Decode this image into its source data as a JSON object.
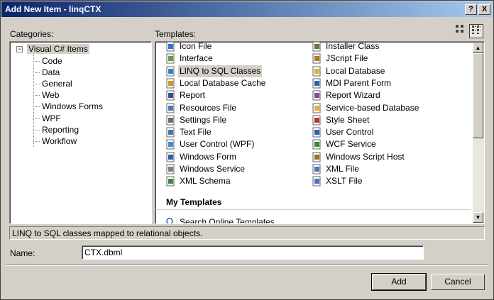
{
  "window": {
    "title": "Add New Item - linqCTX",
    "help_btn": "?",
    "close_btn": "X"
  },
  "categories": {
    "label": "Categories:",
    "root": "Visual C# Items",
    "items": [
      "Code",
      "Data",
      "General",
      "Web",
      "Windows Forms",
      "WPF",
      "Reporting",
      "Workflow"
    ]
  },
  "templates": {
    "label": "Templates:",
    "left": [
      {
        "name": "Icon File",
        "icon": "icon-file-icon",
        "color": "#3b6cc9"
      },
      {
        "name": "Interface",
        "icon": "interface-icon",
        "color": "#5aa33e"
      },
      {
        "name": "LINQ to SQL Classes",
        "icon": "linq-to-sql-icon",
        "color": "#2e7fd1"
      },
      {
        "name": "Local Database Cache",
        "icon": "database-cache-icon",
        "color": "#c99a24"
      },
      {
        "name": "Report",
        "icon": "report-icon",
        "color": "#2f4f8f"
      },
      {
        "name": "Resources File",
        "icon": "resources-file-icon",
        "color": "#4a78b8"
      },
      {
        "name": "Settings File",
        "icon": "settings-file-icon",
        "color": "#6b6b6b"
      },
      {
        "name": "Text File",
        "icon": "text-file-icon",
        "color": "#4c70b0"
      },
      {
        "name": "User Control (WPF)",
        "icon": "wpf-control-icon",
        "color": "#3c8ad6"
      },
      {
        "name": "Windows Form",
        "icon": "windows-form-icon",
        "color": "#2a5fb0"
      },
      {
        "name": "Windows Service",
        "icon": "windows-service-icon",
        "color": "#808080"
      },
      {
        "name": "XML Schema",
        "icon": "xml-schema-icon",
        "color": "#3a8a3a"
      }
    ],
    "right": [
      {
        "name": "Installer Class",
        "icon": "installer-class-icon",
        "color": "#7a6a4a"
      },
      {
        "name": "JScript File",
        "icon": "jscript-file-icon",
        "color": "#b07c20"
      },
      {
        "name": "Local Database",
        "icon": "local-database-icon",
        "color": "#e0b030"
      },
      {
        "name": "MDI Parent Form",
        "icon": "mdi-form-icon",
        "color": "#2a5fb0"
      },
      {
        "name": "Report Wizard",
        "icon": "report-wizard-icon",
        "color": "#8a4a9a"
      },
      {
        "name": "Service-based Database",
        "icon": "service-database-icon",
        "color": "#e0b030"
      },
      {
        "name": "Style Sheet",
        "icon": "style-sheet-icon",
        "color": "#c03030"
      },
      {
        "name": "User Control",
        "icon": "user-control-icon",
        "color": "#2a5fb0"
      },
      {
        "name": "WCF Service",
        "icon": "wcf-service-icon",
        "color": "#3a8a3a"
      },
      {
        "name": "Windows Script Host",
        "icon": "script-host-icon",
        "color": "#a07020"
      },
      {
        "name": "XML File",
        "icon": "xml-file-icon",
        "color": "#4a78b8"
      },
      {
        "name": "XSLT File",
        "icon": "xslt-file-icon",
        "color": "#4a78b8"
      }
    ],
    "my_templates_heading": "My Templates",
    "search_online": "Search Online Templates..."
  },
  "description": "LINQ to SQL classes mapped to relational objects.",
  "name_field": {
    "label": "Name:",
    "value": "CTX.dbml"
  },
  "buttons": {
    "add": "Add",
    "cancel": "Cancel"
  },
  "colors": {
    "title_start": "#0a246a",
    "title_end": "#a6caf0",
    "dialog_bg": "#d4d0c8"
  }
}
